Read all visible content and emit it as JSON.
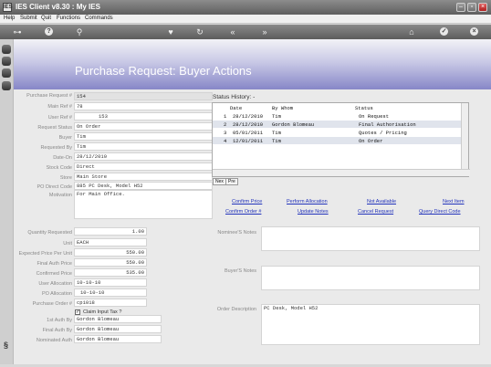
{
  "window": {
    "title": "IES Client v8.30 : My IES",
    "app_icon": "IES"
  },
  "menu": {
    "help": "Help",
    "submit": "Submit",
    "quit": "Quit",
    "functions": "Functions",
    "commands": "Commands"
  },
  "toolbar_icons": [
    "key-icon",
    "help-icon",
    "search-icon",
    "heart-icon",
    "refresh-icon",
    "rewind-icon",
    "fast-forward-icon",
    "home-icon",
    "check-icon",
    "close-icon"
  ],
  "page": {
    "title": "Purchase Request: Buyer Actions"
  },
  "form": {
    "purchase_request_label": "Purchase Request #",
    "purchase_request": "154",
    "main_ref_label": "Main Ref #",
    "main_ref": "78",
    "user_ref_label": "User Ref #",
    "user_ref": "153",
    "request_status_label": "Request Status",
    "request_status": "On Order",
    "buyer_label": "Buyer",
    "buyer": "Tim",
    "requested_by_label": "Requested By",
    "requested_by": "Tim",
    "date_on_label": "Date-On",
    "date_on": "28/12/2010",
    "stock_code_label": "Stock Code",
    "stock_code": "Direct",
    "store_label": "Store",
    "store": "Main Store",
    "po_direct_code_label": "PO Direct Code",
    "po_direct_code": "885 PC Desk, Model H52",
    "motivation_label": "Motivation",
    "motivation": "For Main Office.",
    "quantity_requested_label": "Quantity Requested",
    "quantity_requested": "1.00",
    "unit_label": "Unit",
    "unit": "EACH",
    "expected_price_label": "Expected Price Per Unit",
    "expected_price": "550.00",
    "final_auth_price_label": "Final Auth Price",
    "final_auth_price": "550.00",
    "confirmed_price_label": "Confirmed Price",
    "confirmed_price": "535.00",
    "user_allocation_label": "User Allocation",
    "user_allocation": "10-10-10",
    "po_allocation_label": "PO Allocation",
    "po_allocation": "10-10-10",
    "purchase_order_label": "Purchase Order #",
    "purchase_order": "cp1018",
    "claim_input_tax_label": "Claim Input Tax ?",
    "claim_input_tax_checked": "✓",
    "first_auth_by_label": "1st Auth By",
    "first_auth_by": "Gordon Blomeau",
    "final_auth_by_label": "Final Auth By",
    "final_auth_by": "Gordon Blomeau",
    "nominated_auth_label": "Nominated Auth",
    "nominated_auth": "Gordon Blomeau"
  },
  "status_history": {
    "title": "Status History: -",
    "headers": {
      "date": "Date",
      "by_whom": "By Whom",
      "status": "Status"
    },
    "rows": [
      {
        "num": "1",
        "date": "28/12/2010",
        "by": "Tim",
        "status": "On Request"
      },
      {
        "num": "2",
        "date": "28/12/2010",
        "by": "Gordon Blomeau",
        "status": "Final Authorisation"
      },
      {
        "num": "3",
        "date": "05/01/2011",
        "by": "Tim",
        "status": "Quotes / Pricing"
      },
      {
        "num": "4",
        "date": "12/01/2011",
        "by": "Tim",
        "status": "On Order"
      }
    ],
    "nex_label": "Nex",
    "pre_label": "Pre"
  },
  "actions": {
    "confirm_price": "Confirm Price",
    "perform_allocation": "Perform Allocation",
    "not_available": "Not Available",
    "next_item": "Next Item",
    "confirm_order": "Confirm Order #",
    "update_notes": "Update Notes",
    "cancel_request": "Cancel Request",
    "query_direct_code": "Query Direct Code"
  },
  "notes": {
    "nominee_label": "Nominee'S Notes",
    "nominee": "",
    "buyer_label": "Buyer'S Notes",
    "buyer": "",
    "order_description_label": "Order Description",
    "order_description": "PC Desk, Model H52"
  },
  "left_page_indicator": "§"
}
